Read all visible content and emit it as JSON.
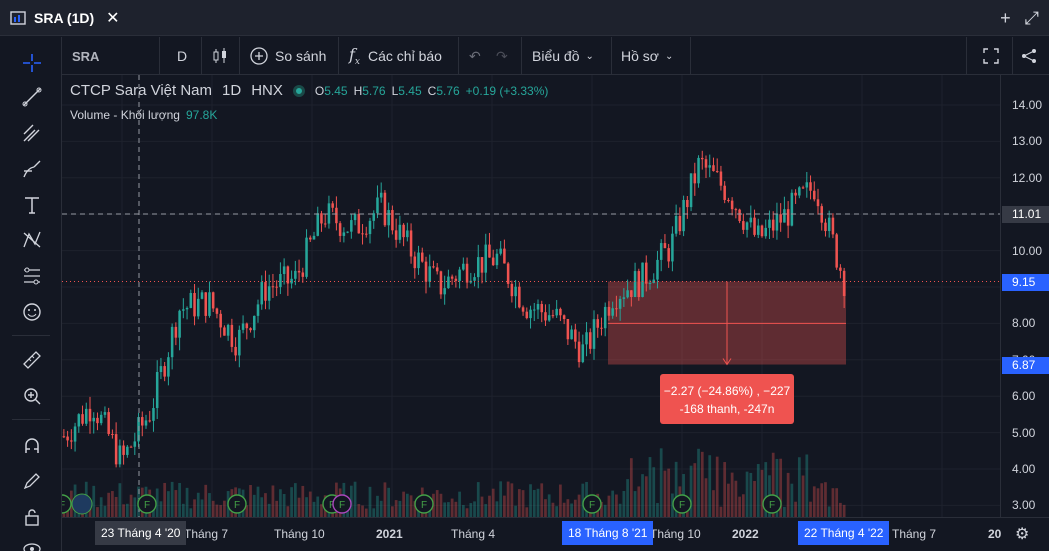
{
  "window": {
    "tab_title": "SRA (1D)",
    "close_icon": "close-icon",
    "add_icon": "plus-icon",
    "expand_icon": "expand-icon"
  },
  "toolbar": {
    "symbol": "SRA",
    "interval": "D",
    "compare_label": "So sánh",
    "indicators_label": "Các chỉ báo",
    "chart_type_label": "Biểu đồ",
    "profile_label": "Hồ sơ"
  },
  "legend": {
    "name": "CTCP Sara Việt Nam",
    "interval": "1D",
    "exchange": "HNX",
    "o_label": "O",
    "o_value": "5.45",
    "h_label": "H",
    "h_value": "5.76",
    "l_label": "L",
    "l_value": "5.45",
    "c_label": "C",
    "c_value": "5.76",
    "change": "+0.19 (+3.33%)",
    "volume_label": "Volume - Khối lượng",
    "volume_value": "97.8K"
  },
  "price_axis": {
    "ticks": [
      "14.00",
      "13.00",
      "12.00",
      "11.00",
      "10.00",
      "9.00",
      "8.00",
      "7.00",
      "6.00",
      "5.00",
      "4.00",
      "3.00"
    ],
    "crosshair_label": "11.01",
    "last_price_label": "9.15",
    "measure_low_label": "6.87"
  },
  "time_axis": {
    "ticks": [
      "Tháng 7",
      "Tháng 10",
      "2021",
      "Tháng 4",
      "Tháng 10",
      "2022",
      "Tháng 7",
      "20"
    ],
    "crosshair_label": "23 Tháng 4 '20",
    "range_start_label": "18 Tháng 8 '21",
    "range_end_label": "22 Tháng 4 '22"
  },
  "measure_tooltip": {
    "line1": "−2.27 (−24.86%) , −227",
    "line2": "-168 thanh, -247n"
  },
  "colors": {
    "up": "#26a69a",
    "down": "#ef5350",
    "background": "#131722",
    "accent": "#2962ff"
  },
  "chart_data": {
    "type": "candlestick",
    "ylim": [
      2.7,
      14.5
    ],
    "x": [
      "2020-01",
      "2020-02",
      "2020-03",
      "2020-04",
      "2020-05",
      "2020-06",
      "2020-07",
      "2020-08",
      "2020-09",
      "2020-10",
      "2020-11",
      "2020-12",
      "2021-01",
      "2021-02",
      "2021-03",
      "2021-04",
      "2021-05",
      "2021-06",
      "2021-07",
      "2021-08",
      "2021-09",
      "2021-10",
      "2021-11",
      "2021-12",
      "2022-01",
      "2022-02",
      "2022-03",
      "2022-04"
    ],
    "close": [
      4.9,
      5.8,
      4.2,
      5.6,
      8.4,
      8.6,
      7.5,
      9.0,
      9.2,
      11.0,
      10.6,
      11.2,
      10.0,
      9.0,
      9.6,
      9.8,
      8.5,
      8.2,
      7.2,
      8.8,
      9.2,
      10.1,
      12.4,
      11.6,
      10.3,
      11.0,
      11.8,
      9.2
    ],
    "volume_labels_in_chart": "not printed",
    "event_markers": [
      "F",
      "F",
      "F",
      "F",
      "F",
      "F",
      "F",
      "F"
    ],
    "measure": {
      "from": 9.15,
      "to": 6.87,
      "change": -2.27
    }
  }
}
